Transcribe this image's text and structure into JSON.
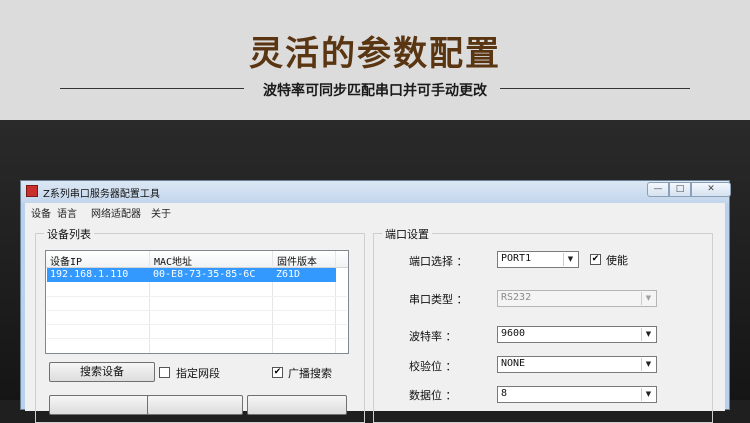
{
  "banner": {
    "headline": "灵活的参数配置",
    "subline": "波特率可同步匹配串口并可手动更改"
  },
  "window": {
    "title": "Z系列串口服务器配置工具",
    "min_glyph": "—",
    "max_glyph": "□",
    "close_glyph": "✕"
  },
  "menu": {
    "items": [
      "设备",
      "语言",
      "网络适配器",
      "关于"
    ]
  },
  "device_list": {
    "group_label": "设备列表",
    "columns": [
      "设备IP",
      "MAC地址",
      "固件版本"
    ],
    "rows": [
      {
        "ip": "192.168.1.110",
        "mac": "00-E8-73-35-85-6C",
        "firmware": "Z61D"
      }
    ]
  },
  "actions": {
    "search_button": "搜索设备",
    "specify_segment_label": "指定网段",
    "specify_segment_checked": false,
    "broadcast_label": "广播搜索",
    "broadcast_checked": true
  },
  "port_settings": {
    "group_label": "端口设置",
    "port_select": {
      "label": "端口选择 ：",
      "value": "PORT1"
    },
    "enable": {
      "label": "使能",
      "checked": true
    },
    "serial_type": {
      "label": "串口类型 ：",
      "value": "RS232",
      "disabled": true
    },
    "baud_rate": {
      "label": "波特率 ：",
      "value": "9600"
    },
    "parity": {
      "label": "校验位 ：",
      "value": "NONE"
    },
    "data_bits": {
      "label": "数据位 ：",
      "value": "8"
    }
  },
  "colors": {
    "headline": "#5a3512",
    "selection": "#3399ff"
  }
}
